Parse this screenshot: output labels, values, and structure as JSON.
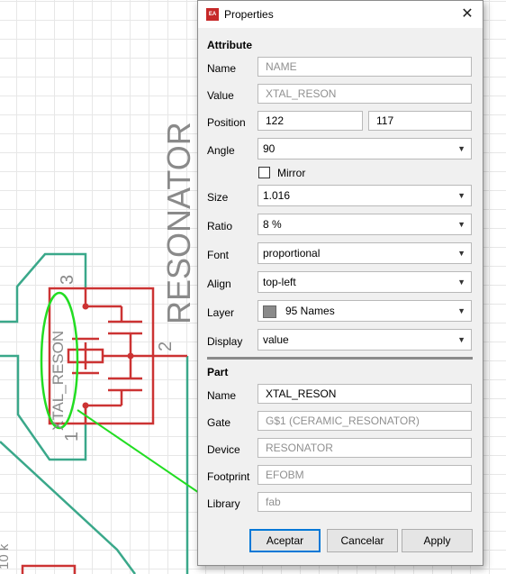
{
  "schematic": {
    "resonator_label": "RESONATOR",
    "name_label": "XTAL_RESON",
    "pin_1": "1",
    "pin_2": "2",
    "pin_3": "3",
    "partial_label": "10 k"
  },
  "dialog": {
    "title": "Properties",
    "close_symbol": "✕",
    "attribute_section": "Attribute",
    "fields": {
      "name": {
        "label": "Name",
        "placeholder": "NAME"
      },
      "value": {
        "label": "Value",
        "value": "XTAL_RESON"
      },
      "position": {
        "label": "Position",
        "x": "122",
        "y": "117"
      },
      "angle": {
        "label": "Angle",
        "value": "90"
      },
      "mirror": {
        "label": "Mirror",
        "checked": false
      },
      "size": {
        "label": "Size",
        "value": "1.016"
      },
      "ratio": {
        "label": "Ratio",
        "value": "8 %"
      },
      "font": {
        "label": "Font",
        "value": "proportional"
      },
      "align": {
        "label": "Align",
        "value": "top-left"
      },
      "layer": {
        "label": "Layer",
        "value": "95 Names",
        "swatch_color": "#8a8a8a"
      },
      "display": {
        "label": "Display",
        "value": "value"
      }
    },
    "part_section": "Part",
    "part": {
      "name": {
        "label": "Name",
        "value": "XTAL_RESON"
      },
      "gate": {
        "label": "Gate",
        "value": "G$1 (CERAMIC_RESONATOR)"
      },
      "device": {
        "label": "Device",
        "value": "RESONATOR"
      },
      "footprint": {
        "label": "Footprint",
        "value": "EFOBM"
      },
      "library": {
        "label": "Library",
        "value": "fab"
      }
    },
    "buttons": {
      "ok": "Aceptar",
      "cancel": "Cancelar",
      "apply": "Apply"
    }
  },
  "colors": {
    "part_outline": "#cc3333",
    "net_outline": "#3aa88a",
    "annotation": "#22dd22",
    "label_gray": "#8a8a8a",
    "accent": "#0078d7"
  }
}
